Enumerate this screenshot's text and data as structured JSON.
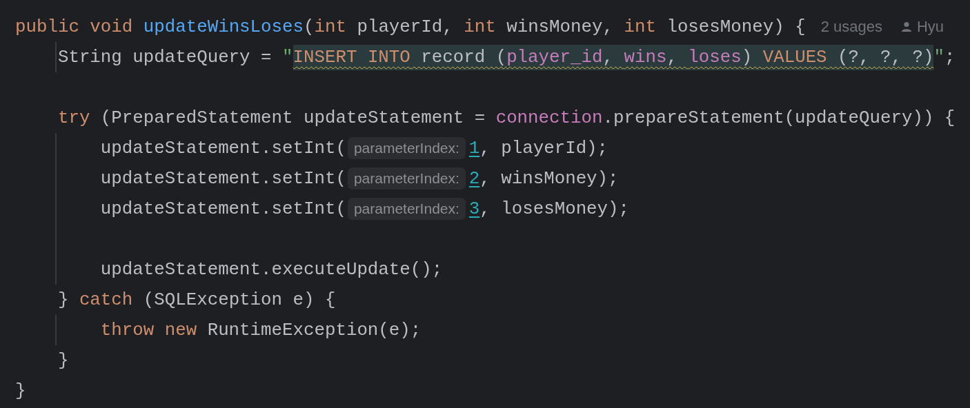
{
  "editor": {
    "lines": [
      {
        "kind": "code",
        "indent_guide": false,
        "tokens": [
          {
            "kind": "keyword",
            "text": "public void "
          },
          {
            "kind": "function",
            "text": "updateWinsLoses"
          },
          {
            "kind": "plain",
            "text": "("
          },
          {
            "kind": "keyword",
            "text": "int "
          },
          {
            "kind": "plain",
            "text": "playerId, "
          },
          {
            "kind": "keyword",
            "text": "int "
          },
          {
            "kind": "plain",
            "text": "winsMoney, "
          },
          {
            "kind": "keyword",
            "text": "int "
          },
          {
            "kind": "plain",
            "text": "losesMoney) {"
          }
        ],
        "usages": "2 usages",
        "author": "Hyu"
      },
      {
        "kind": "code",
        "indent_guide": true,
        "tokens": [
          {
            "kind": "plain",
            "text": "    String updateQuery = "
          },
          {
            "kind": "string",
            "text": "\""
          },
          {
            "kind": "sqlkeyword",
            "text": "INSERT INTO"
          },
          {
            "kind": "sql",
            "text": " record ("
          },
          {
            "kind": "sqlcolumn",
            "text": "player_id"
          },
          {
            "kind": "sql",
            "text": ", "
          },
          {
            "kind": "sqlcolumn",
            "text": "wins"
          },
          {
            "kind": "sql",
            "text": ", "
          },
          {
            "kind": "sqlcolumn",
            "text": "loses"
          },
          {
            "kind": "sql",
            "text": ") "
          },
          {
            "kind": "sqlkeyword",
            "text": "VALUES"
          },
          {
            "kind": "sql",
            "text": " (?, ?, ?)"
          },
          {
            "kind": "string",
            "text": "\""
          },
          {
            "kind": "plain",
            "text": ";"
          }
        ]
      },
      {
        "kind": "blank",
        "indent_guide": false
      },
      {
        "kind": "code",
        "indent_guide": false,
        "tokens": [
          {
            "kind": "keyword",
            "text": "    try "
          },
          {
            "kind": "plain",
            "text": "(PreparedStatement updateStatement = "
          },
          {
            "kind": "field",
            "text": "connection"
          },
          {
            "kind": "plain",
            "text": ".prepareStatement(updateQuery)) {"
          }
        ]
      },
      {
        "kind": "code",
        "indent_guide": true,
        "tokens": [
          {
            "kind": "plain",
            "text": "        updateStatement.setInt("
          },
          {
            "kind": "hint",
            "text": "parameterIndex:"
          },
          {
            "kind": "number",
            "text": "1"
          },
          {
            "kind": "plain",
            "text": ", playerId);"
          }
        ]
      },
      {
        "kind": "code",
        "indent_guide": true,
        "tokens": [
          {
            "kind": "plain",
            "text": "        updateStatement.setInt("
          },
          {
            "kind": "hint",
            "text": "parameterIndex:"
          },
          {
            "kind": "number",
            "text": "2"
          },
          {
            "kind": "plain",
            "text": ", winsMoney);"
          }
        ]
      },
      {
        "kind": "code",
        "indent_guide": true,
        "tokens": [
          {
            "kind": "plain",
            "text": "        updateStatement.setInt("
          },
          {
            "kind": "hint",
            "text": "parameterIndex:"
          },
          {
            "kind": "number",
            "text": "3"
          },
          {
            "kind": "plain",
            "text": ", losesMoney);"
          }
        ]
      },
      {
        "kind": "blank",
        "indent_guide": true
      },
      {
        "kind": "code",
        "indent_guide": true,
        "tokens": [
          {
            "kind": "plain",
            "text": "        updateStatement.executeUpdate();"
          }
        ]
      },
      {
        "kind": "code",
        "indent_guide": false,
        "tokens": [
          {
            "kind": "plain",
            "text": "    } "
          },
          {
            "kind": "keyword",
            "text": "catch "
          },
          {
            "kind": "plain",
            "text": "(SQLException e) {"
          }
        ]
      },
      {
        "kind": "code",
        "indent_guide": true,
        "tokens": [
          {
            "kind": "keyword",
            "text": "        throw new "
          },
          {
            "kind": "plain",
            "text": "RuntimeException(e);"
          }
        ]
      },
      {
        "kind": "code",
        "indent_guide": false,
        "tokens": [
          {
            "kind": "plain",
            "text": "    }"
          }
        ]
      },
      {
        "kind": "code",
        "indent_guide": false,
        "tokens": [
          {
            "kind": "plain",
            "text": "}"
          }
        ]
      }
    ]
  }
}
